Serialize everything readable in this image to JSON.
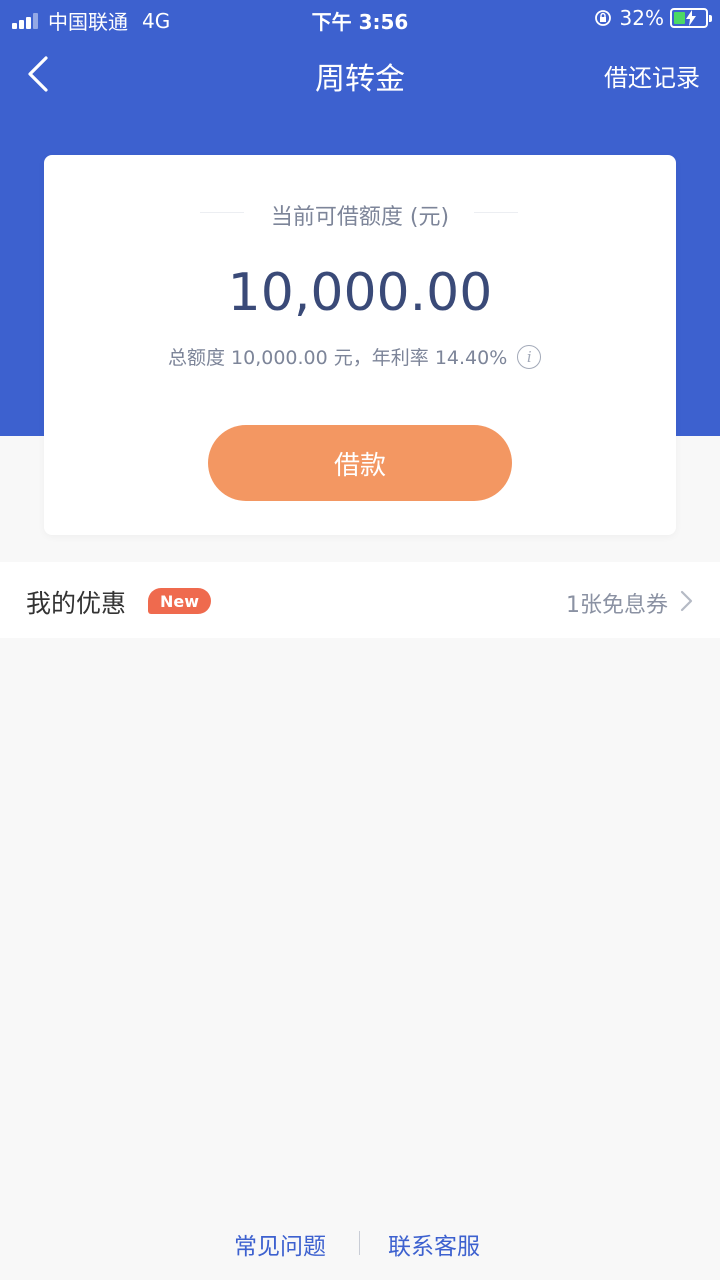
{
  "status_bar": {
    "carrier": "中国联通",
    "network": "4G",
    "time": "下午 3:56",
    "battery": "32%"
  },
  "nav": {
    "title": "周转金",
    "right_action": "借还记录"
  },
  "card": {
    "label": "当前可借额度 (元)",
    "amount": "10,000.00",
    "subinfo": "总额度 10,000.00 元，年利率 14.40%",
    "info_icon_char": "i",
    "borrow_label": "借款"
  },
  "promo": {
    "title": "我的优惠",
    "badge": "New",
    "value": "1张免息券"
  },
  "footer": {
    "faq": "常见问题",
    "service": "联系客服"
  },
  "colors": {
    "header_blue": "#3d61cf",
    "button_orange": "#f39762",
    "badge_red": "#ef6a4e",
    "amount_navy": "#3a4a78"
  }
}
